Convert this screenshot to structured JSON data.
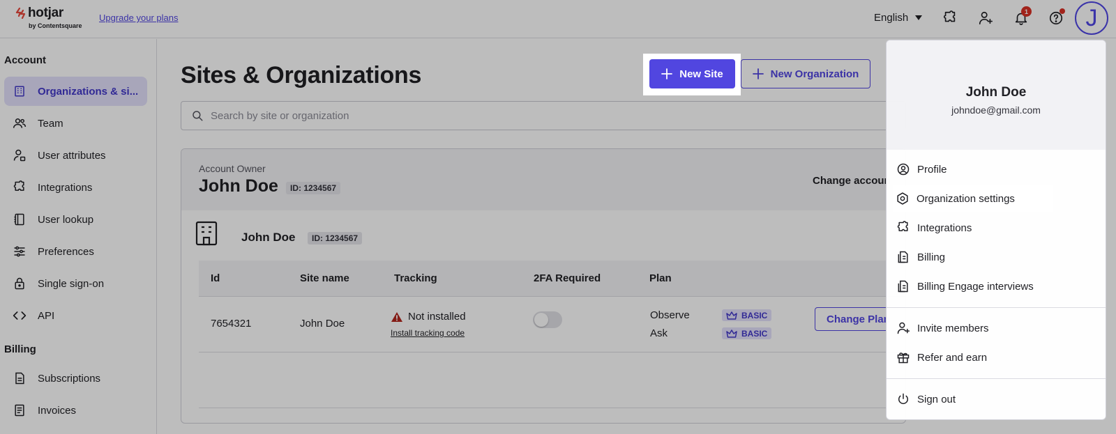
{
  "topbar": {
    "logo_text": "hotjar",
    "logo_sub": "by Contentsquare",
    "upgrade_link": "Upgrade your plans",
    "language": "English",
    "notification_count": "1",
    "avatar_initial": "J"
  },
  "sidebar": {
    "account_heading": "Account",
    "account_items": [
      {
        "label": "Organizations & si...",
        "icon": "building-icon",
        "active": true
      },
      {
        "label": "Team",
        "icon": "team-icon"
      },
      {
        "label": "User attributes",
        "icon": "user-attributes-icon"
      },
      {
        "label": "Integrations",
        "icon": "puzzle-icon"
      },
      {
        "label": "User lookup",
        "icon": "book-icon"
      },
      {
        "label": "Preferences",
        "icon": "sliders-icon"
      },
      {
        "label": "Single sign-on",
        "icon": "lock-icon"
      },
      {
        "label": "API",
        "icon": "code-icon"
      }
    ],
    "billing_heading": "Billing",
    "billing_items": [
      {
        "label": "Subscriptions",
        "icon": "document-icon"
      },
      {
        "label": "Invoices",
        "icon": "receipt-icon"
      }
    ]
  },
  "main": {
    "title": "Sites & Organizations",
    "new_site": "New Site",
    "new_organization": "New Organization",
    "search_placeholder": "Search by site or organization",
    "card": {
      "owner_label": "Account Owner",
      "owner_name": "John Doe",
      "owner_id": "ID: 1234567",
      "change_account": "Change accoun",
      "org_name": "John Doe",
      "org_id": "ID: 1234567",
      "columns": [
        "Id",
        "Site name",
        "Tracking",
        "2FA Required",
        "Plan"
      ],
      "row": {
        "id": "7654321",
        "site_name": "John Doe",
        "tracking_status": "Not installed",
        "tracking_link": "Install tracking code",
        "twofa_enabled": false,
        "plans": [
          {
            "name": "Observe",
            "tier": "BASIC"
          },
          {
            "name": "Ask",
            "tier": "BASIC"
          }
        ],
        "change_plan": "Change Plan"
      }
    }
  },
  "dropdown": {
    "name": "John Doe",
    "email": "johndoe@gmail.com",
    "items": [
      {
        "label": "Profile",
        "icon": "user-circle-icon"
      },
      {
        "label": "Organization settings",
        "icon": "settings-hex-icon"
      },
      {
        "label": "Integrations",
        "icon": "puzzle-icon"
      },
      {
        "label": "Billing",
        "icon": "billing-icon"
      },
      {
        "label": "Billing Engage interviews",
        "icon": "billing-icon"
      },
      {
        "label": "Invite members",
        "icon": "user-plus-icon"
      },
      {
        "label": "Refer and earn",
        "icon": "gift-icon"
      },
      {
        "label": "Sign out",
        "icon": "power-icon"
      }
    ]
  },
  "colors": {
    "accent": "#5146e0",
    "active_bg": "#e3e1fb",
    "warning": "#b3261e"
  }
}
